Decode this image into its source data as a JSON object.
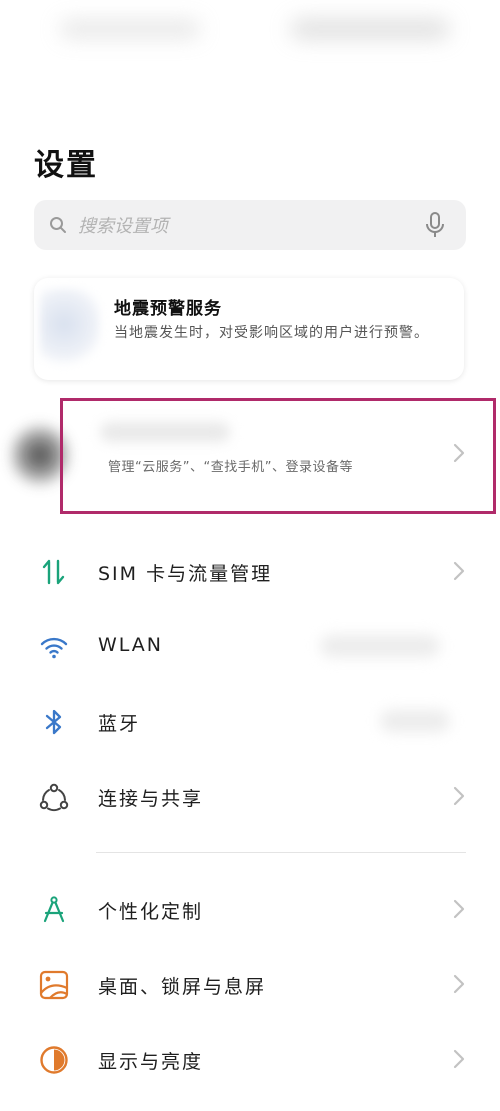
{
  "header": {
    "title": "设置"
  },
  "search": {
    "placeholder": "搜索设置项"
  },
  "alert_card": {
    "title": "地震预警服务",
    "description": "当地震发生时，对受影响区域的用户进行预警。"
  },
  "account": {
    "description": "管理“云服务”、“查找手机”、登录设备等"
  },
  "settings": [
    {
      "label": "SIM 卡与流量管理",
      "icon": "sim-data-icon",
      "color": "#1aa37a"
    },
    {
      "label": "WLAN",
      "icon": "wifi-icon",
      "color": "#3a78c9"
    },
    {
      "label": "蓝牙",
      "icon": "bluetooth-icon",
      "color": "#3a78c9"
    },
    {
      "label": "连接与共享",
      "icon": "connection-sharing-icon",
      "color": "#444444"
    },
    {
      "label": "个性化定制",
      "icon": "personalization-icon",
      "color": "#1aa37a"
    },
    {
      "label": "桌面、锁屏与息屏",
      "icon": "home-lock-screen-icon",
      "color": "#e07a2c"
    },
    {
      "label": "显示与亮度",
      "icon": "display-brightness-icon",
      "color": "#e07a2c"
    }
  ],
  "colors": {
    "highlight_border": "#b02a6a",
    "chevron": "#c2c2c2"
  }
}
